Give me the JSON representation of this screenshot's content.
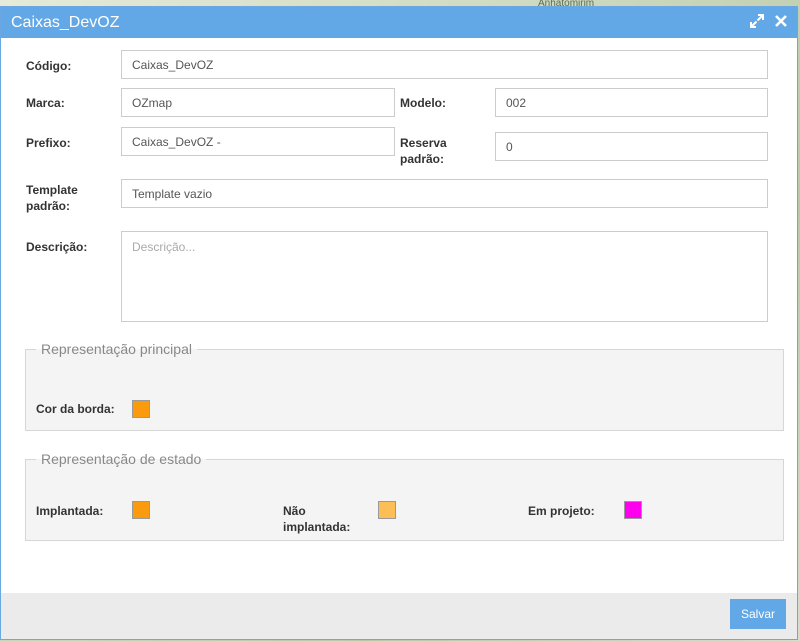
{
  "window": {
    "title": "Caixas_DevOZ",
    "bg_map_label": "Anhatomirim",
    "icons": {
      "maximize": "expand-arrows-icon",
      "close": "close-icon"
    }
  },
  "form": {
    "codigo": {
      "label": "Código:",
      "value": "Caixas_DevOZ"
    },
    "marca": {
      "label": "Marca:",
      "value": "OZmap"
    },
    "modelo": {
      "label": "Modelo:",
      "value": "002"
    },
    "prefixo": {
      "label": "Prefixo:",
      "value": "Caixas_DevOZ -"
    },
    "reserva": {
      "label_line1": "Reserva",
      "label_line2": "padrão:",
      "value": "0"
    },
    "template": {
      "label_line1": "Template",
      "label_line2": "padrão:",
      "value": "Template vazio"
    },
    "descricao": {
      "label": "Descrição:",
      "value": "",
      "placeholder": "Descrição..."
    }
  },
  "principal": {
    "legend": "Representação principal",
    "cor_borda": {
      "label": "Cor da borda:",
      "color": "#f99b0c"
    }
  },
  "estado": {
    "legend": "Representação de estado",
    "implantada": {
      "label": "Implantada:",
      "color": "#f99b0c"
    },
    "nao_implantada": {
      "label_line1": "Não",
      "label_line2": "implantada:",
      "color": "#fbbf56"
    },
    "em_projeto": {
      "label": "Em projeto:",
      "color": "#ff00ee"
    }
  },
  "footer": {
    "save_label": "Salvar"
  }
}
